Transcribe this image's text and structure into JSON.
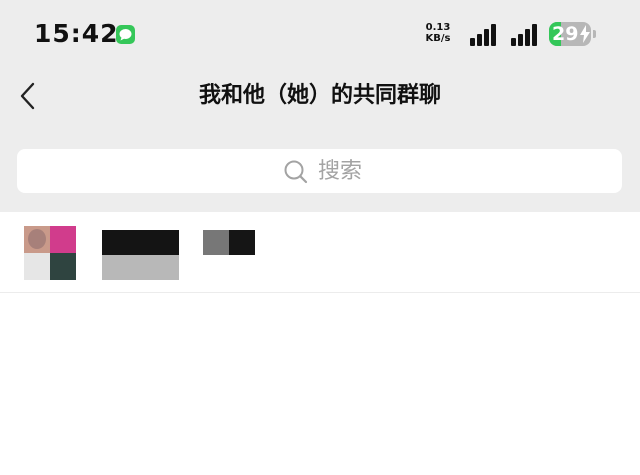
{
  "status_bar": {
    "time": "15:42",
    "net_speed_value": "0.13",
    "net_speed_unit": "KB/s",
    "battery_level": "29",
    "battery_fraction": 0.29,
    "message_icon": "message-bubble-icon",
    "signal_icon": "signal-bars-icon",
    "battery_icon": "battery-charging-icon"
  },
  "nav": {
    "back_icon": "chevron-left-icon",
    "title": "我和他（她）的共同群聊"
  },
  "search": {
    "icon": "search-icon",
    "placeholder": "搜索"
  },
  "groups": [
    {
      "avatar": "group-avatar-collage",
      "name_obscured": true,
      "count_obscured": true
    }
  ],
  "colors": {
    "header_background": "#ededed",
    "list_background": "#ffffff",
    "accent_green": "#34c759",
    "placeholder_text": "#a3a3a3"
  }
}
